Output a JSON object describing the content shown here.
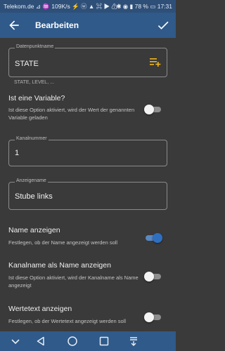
{
  "status_bar": {
    "left": "Telekom.de ⊿ ♒ 109K/s ⚡ ⓦ ▲ ⌘ ▶ ⚠ ⁝",
    "right": "✱ ◉ ▮ 78 % ▭ 17:31"
  },
  "appbar": {
    "title": "Bearbeiten",
    "back_icon": "arrow-left-icon",
    "confirm_icon": "check-icon"
  },
  "form": {
    "datapoint": {
      "label": "Datenpunktname",
      "value": "STATE",
      "hint": "STATE, LEVEL, ..."
    },
    "is_variable": {
      "title": "Ist eine Variable?",
      "description": "Ist diese Option aktiviert, wird der Wert der genannten Variable geladen",
      "enabled": false
    },
    "channel_number": {
      "label": "Kanalnummer",
      "value": "1"
    },
    "display_name": {
      "label": "Anzeigename",
      "value": "Stube links"
    },
    "show_name": {
      "title": "Name anzeigen",
      "description": "Festlegen, ob der Name angezeigt werden soll",
      "enabled": true
    },
    "channel_as_name": {
      "title": "Kanalname als Name anzeigen",
      "description": "Ist diese Option aktiviert, wird der Kanalname als Name angezeigt",
      "enabled": false
    },
    "value_text": {
      "title": "Wertetext anzeigen",
      "description": "Festlegen, ob der Wertetext angezeigt werden soll",
      "enabled": false
    }
  },
  "colors": {
    "appbar": "#2f5a8a",
    "background": "#3a3a3a",
    "accent": "#f2b51b",
    "toggle_on": "#2f6fc0"
  },
  "navbar": {
    "icons": [
      "chevron-down-icon",
      "back-triangle-icon",
      "home-circle-icon",
      "recents-square-icon",
      "notification-pull-icon"
    ]
  }
}
